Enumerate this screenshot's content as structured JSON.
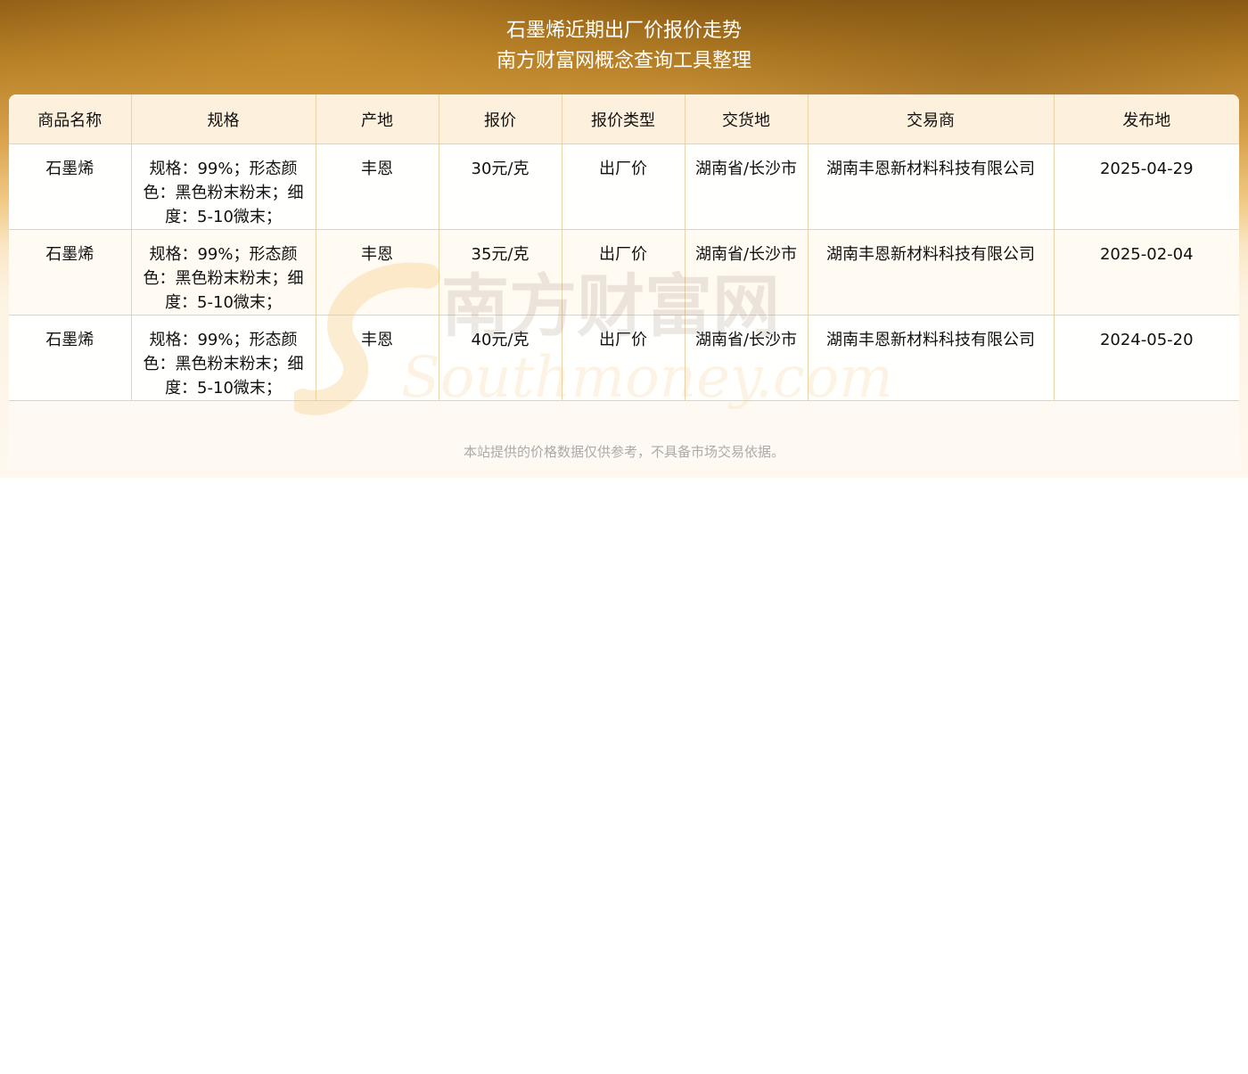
{
  "title": {
    "line1": "石墨烯近期出厂价报价走势",
    "line2": "南方财富网概念查询工具整理"
  },
  "table": {
    "headers": [
      "商品名称",
      "规格",
      "产地",
      "报价",
      "报价类型",
      "交货地",
      "交易商",
      "发布地"
    ],
    "rows": [
      [
        "石墨烯",
        "规格：99%；形态颜色：黑色粉末粉末；细度：5-10微末；",
        "丰恩",
        "30元/克",
        "出厂价",
        "湖南省/长沙市",
        "湖南丰恩新材料科技有限公司",
        "2025-04-29"
      ],
      [
        "石墨烯",
        "规格：99%；形态颜色：黑色粉末粉末；细度：5-10微末；",
        "丰恩",
        "35元/克",
        "出厂价",
        "湖南省/长沙市",
        "湖南丰恩新材料科技有限公司",
        "2025-02-04"
      ],
      [
        "石墨烯",
        "规格：99%；形态颜色：黑色粉末粉末；细度：5-10微末；",
        "丰恩",
        "40元/克",
        "出厂价",
        "湖南省/长沙市",
        "湖南丰恩新材料科技有限公司",
        "2024-05-20"
      ]
    ]
  },
  "watermark": {
    "cn": "南方财富网",
    "en": "Southmoney.com"
  },
  "disclaimer": "本站提供的价格数据仅供参考，不具备市场交易依据。",
  "colors": {
    "banner_dark": "#8a5a14",
    "header_bg": "#fdf1dd",
    "border": "#ead3a8",
    "disclaimer": "#aaaaaa"
  }
}
